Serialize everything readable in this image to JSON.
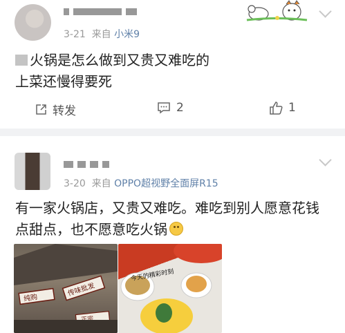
{
  "post1": {
    "time": "3-21",
    "source_prefix": "来自",
    "device": "小米9",
    "line1": "火锅是怎么做到又贵又难吃的",
    "line2": "上菜还慢得要死",
    "actions": {
      "repost_label": "转发",
      "comment_count": "2",
      "like_count": "1"
    }
  },
  "post2": {
    "time": "3-20",
    "source_prefix": "来自",
    "device": "OPPO超视野全面屏R15",
    "line1": "有一家火锅店，又贵又难吃。难吃到别人愿意花钱",
    "line2": "点甜点，也不愿意吃火锅",
    "photo1_signs": [
      "纯购",
      "传味批发",
      "正宗"
    ],
    "photo2_caption": "今天的精彩时刻"
  },
  "colors": {
    "link": "#5f80a8",
    "meta": "#999999",
    "divider": "#f1f2f4"
  }
}
